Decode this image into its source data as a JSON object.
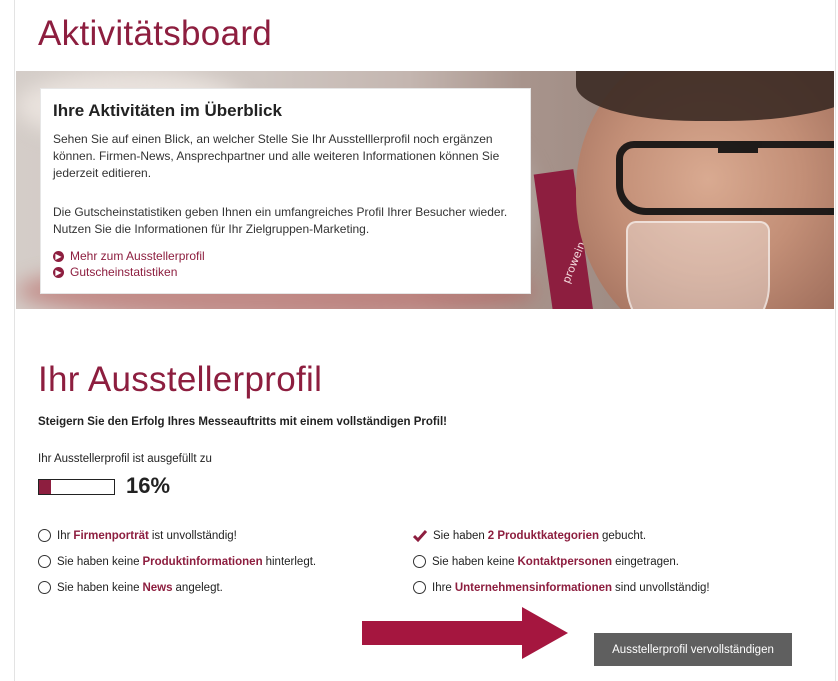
{
  "page": {
    "title": "Aktivitätsboard"
  },
  "hero": {
    "heading": "Ihre Aktivitäten im Überblick",
    "paragraph1": "Sehen Sie auf einen Blick, an welcher Stelle Sie Ihr Ausstelllerprofil noch ergänzen können. Firmen-News, Ansprechpartner und alle weiteren Informationen können Sie jederzeit editieren.",
    "paragraph2": "Die Gutscheinstatistiken geben Ihnen ein umfangreiches Profil Ihrer Besucher wieder. Nutzen Sie die Informationen für Ihr Zielgruppen-Marketing.",
    "links": [
      "Mehr zum Ausstellerprofil",
      "Gutscheinstatistiken"
    ],
    "lanyard_text": "prowein"
  },
  "profile": {
    "title": "Ihr Ausstellerprofil",
    "subtitle": "Steigern Sie den Erfolg Ihres Messeauftritts mit einem vollständigen Profil!",
    "progress_label": "Ihr Ausstellerprofil ist ausgefüllt zu",
    "progress_percent": 16,
    "progress_text": "16%",
    "items": [
      {
        "pre": "Ihr",
        "link": "Firmenporträt",
        "post": "ist unvollständig!",
        "done": false
      },
      {
        "pre": "Sie haben keine",
        "link": "Produktinformationen",
        "post": "hinterlegt.",
        "done": false
      },
      {
        "pre": "Sie haben keine",
        "link": "News",
        "post": "angelegt.",
        "done": false
      },
      {
        "pre": "Sie haben",
        "link": "2 Produktkategorien",
        "post": "gebucht.",
        "done": true
      },
      {
        "pre": "Sie haben keine",
        "link": "Kontaktpersonen",
        "post": "eingetragen.",
        "done": false
      },
      {
        "pre": "Ihre",
        "link": "Unternehmensinformationen",
        "post": "sind unvollständig!",
        "done": false
      }
    ],
    "button_label": "Ausstellerprofil vervollständigen"
  },
  "colors": {
    "accent": "#8d1e3f",
    "button": "#5f5f5f"
  }
}
